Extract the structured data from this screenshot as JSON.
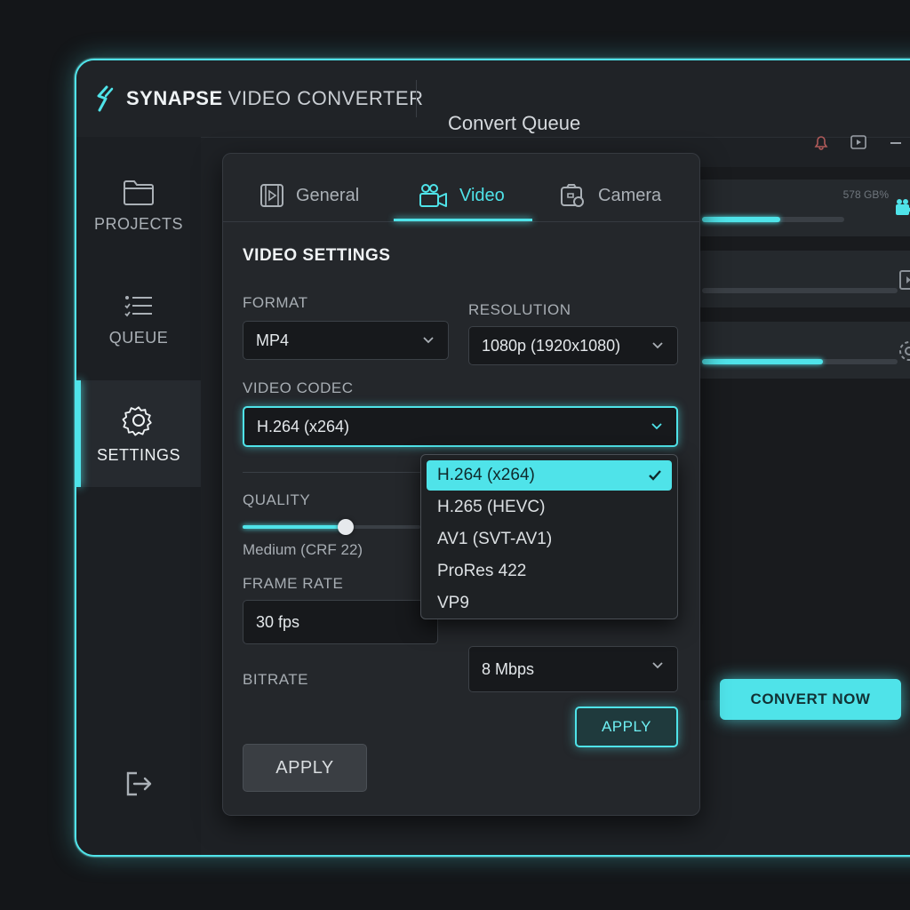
{
  "app": {
    "brand_strong": "SYNAPSE",
    "brand_light": "VIDEO CONVERTER",
    "queue_title": "Convert Queue"
  },
  "sidebar": {
    "items": [
      {
        "label": "PROJECTS",
        "icon": "folder-icon"
      },
      {
        "label": "QUEUE",
        "icon": "list-icon"
      },
      {
        "label": "SETTINGS",
        "icon": "gear-icon",
        "active": true
      }
    ],
    "logout_icon": "logout-icon"
  },
  "queue": {
    "rows": [
      {
        "size": "578 GB%",
        "progress": 0.55
      },
      {
        "size": "",
        "progress": 0.0
      },
      {
        "size": "",
        "progress": 0.62
      }
    ],
    "convert_now_label": "CONVERT NOW"
  },
  "settings": {
    "tabs": [
      {
        "label": "General",
        "icon": "film-icon"
      },
      {
        "label": "Video",
        "icon": "video-camera-icon",
        "active": true
      },
      {
        "label": "Camera",
        "icon": "camera-icon"
      }
    ],
    "section_title": "VIDEO SETTINGS",
    "format": {
      "label": "FORMAT",
      "value": "MP4"
    },
    "resolution": {
      "label": "RESOLUTION",
      "value": "1080p (1920x1080)"
    },
    "video_codec": {
      "label": "VIDEO CODEC",
      "value": "H.264 (x264)",
      "options": [
        "H.264 (x264)",
        "H.265 (HEVC)",
        "AV1 (SVT-AV1)",
        "ProRes 422",
        "VP9"
      ],
      "selected_index": 0
    },
    "quality": {
      "label": "QUALITY",
      "value_text": "Medium (CRF 22)",
      "level": 0.58
    },
    "frame_rate": {
      "label": "FRAME RATE",
      "value": "30 fps"
    },
    "bitrate": {
      "label": "BITRATE",
      "value": "8 Mbps"
    },
    "apply_label": "APPLY",
    "apply_secondary_label": "APPLY"
  },
  "colors": {
    "accent": "#4fe3e9",
    "background": "#141619",
    "panel": "#24272b"
  }
}
